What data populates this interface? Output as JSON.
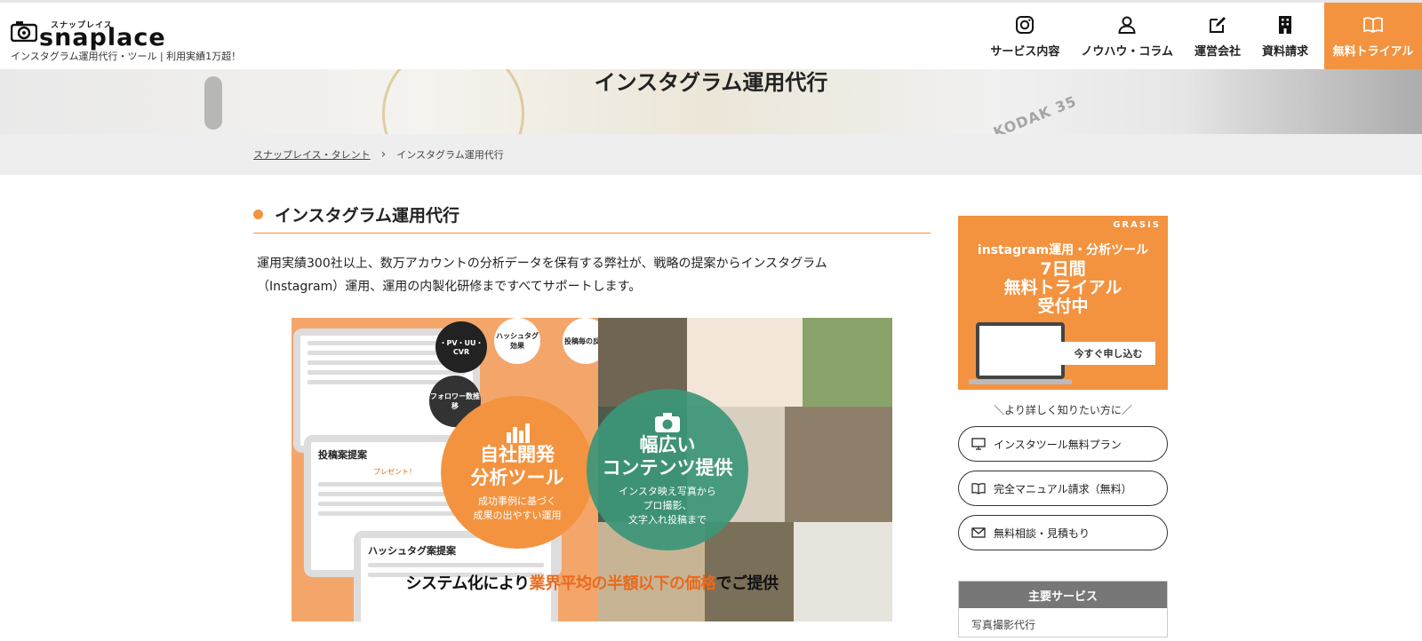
{
  "header": {
    "logo_kana": "スナップレイス",
    "logo_word": "snaplace",
    "tagline": "インスタグラム運用代行・ツール | 利用実績1万超！",
    "nav": [
      {
        "label": "サービス内容",
        "icon": "instagram-icon"
      },
      {
        "label": "ノウハウ・コラム",
        "icon": "user-icon"
      },
      {
        "label": "運営会社",
        "icon": "edit-icon"
      },
      {
        "label": "資料請求",
        "icon": "building-icon"
      },
      {
        "label": "無料トライアル",
        "icon": "book-icon"
      }
    ],
    "accent": "#f3933f"
  },
  "hero": {
    "title": "インスタグラム運用代行",
    "deco_text": "KODAK 35"
  },
  "breadcrumb": {
    "home": "スナップレイス・タレント",
    "current": "インスタグラム運用代行"
  },
  "main": {
    "heading": "インスタグラム運用代行",
    "intro_line1": "運用実績300社以上、数万アカウントの分析データを保有する弊社が、戦略の提案からインスタグラム",
    "intro_line2": "（Instagram）運用、運用の内製化研修まですべてサポートします。"
  },
  "banner": {
    "hashtag_bubble": "ハッシュタグ効果",
    "pv_bubble": "・PV・UU・CVR",
    "post_reaction": "投稿毎の反応",
    "follower_bubble": "フォロワー数推移",
    "post_proposal": "投稿案提案",
    "present_label": "プレゼント！",
    "hashtag_proposal": "ハッシュタグ案提案",
    "circle1_title": "自社開発\n分析ツール",
    "circle1_sub": "成功事例に基づく\n成果の出やすい運用",
    "circle2_title": "幅広い\nコンテンツ提供",
    "circle2_sub": "インスタ映え写真から\nプロ撮影、\n文字入れ投稿まで",
    "caption_pre": "システム化により",
    "caption_hl": "業界平均の半額以下の価格",
    "caption_post": "でご提供"
  },
  "sidebar": {
    "ad": {
      "brand": "GRASIS",
      "line1": "instagram運用・分析ツール",
      "line2": "7日間\n無料トライアル\n受付中",
      "cta": "今すぐ申し込む"
    },
    "sub_heading": "＼より詳しく知りたい方に／",
    "buttons": [
      {
        "label": "インスタツール無料プラン",
        "icon": "monitor-icon"
      },
      {
        "label": "完全マニュアル請求（無料）",
        "icon": "book-icon"
      },
      {
        "label": "無料相談・見積もり",
        "icon": "mail-icon"
      }
    ],
    "services_heading": "主要サービス",
    "services_first": "写真撮影代行"
  }
}
